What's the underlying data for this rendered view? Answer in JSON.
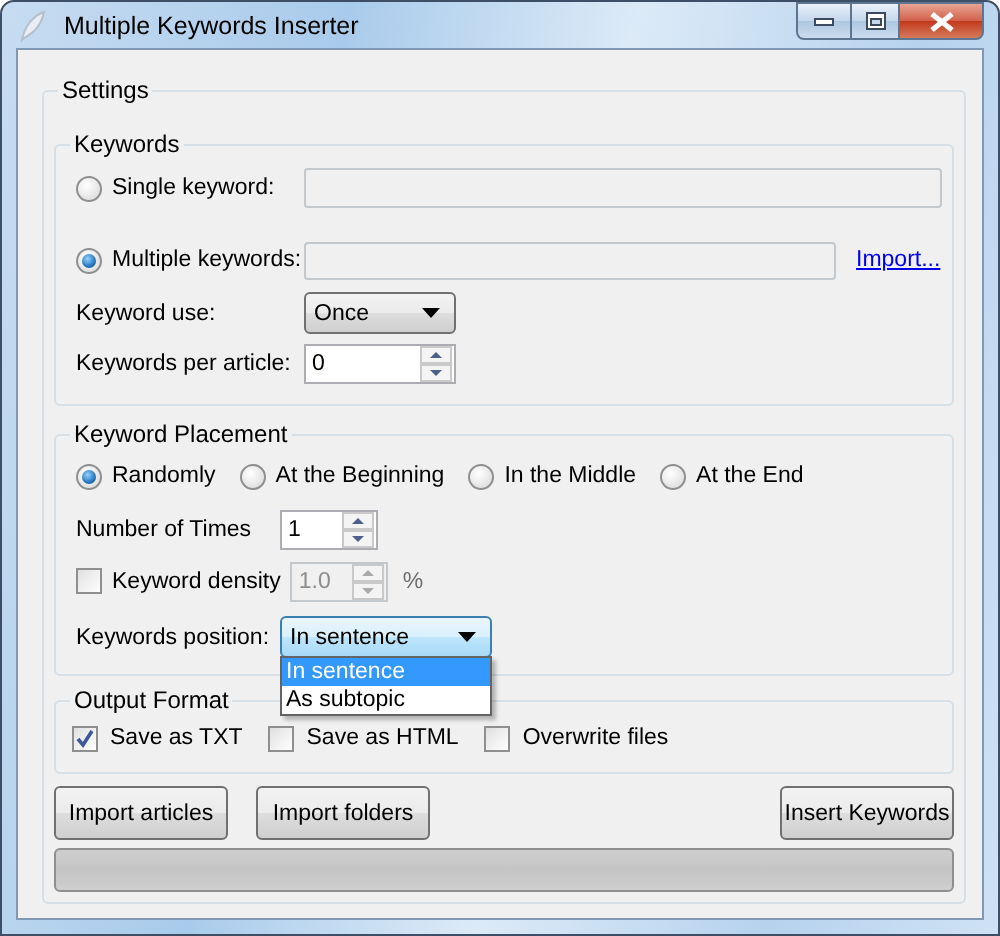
{
  "window": {
    "title": "Multiple Keywords Inserter"
  },
  "settings": {
    "title": "Settings",
    "keywords": {
      "title": "Keywords",
      "single": {
        "label": "Single keyword:",
        "selected": false
      },
      "multiple": {
        "label": "Multiple keywords:",
        "selected": true,
        "link": "Import..."
      },
      "keyword_use": {
        "label": "Keyword use:",
        "value": "Once"
      },
      "per_article": {
        "label": "Keywords per article:",
        "value": "0"
      }
    },
    "placement": {
      "title": "Keyword Placement",
      "options": [
        {
          "label": "Randomly",
          "selected": true
        },
        {
          "label": "At the Beginning",
          "selected": false
        },
        {
          "label": "In the Middle",
          "selected": false
        },
        {
          "label": "At the End",
          "selected": false
        }
      ],
      "times": {
        "label": "Number of Times",
        "value": "1"
      },
      "density": {
        "label": "Keyword density",
        "checked": false,
        "value": "1.0",
        "unit": "%"
      },
      "position": {
        "label": "Keywords position:",
        "value": "In sentence",
        "expanded": true,
        "options": [
          {
            "label": "In sentence",
            "selected": true
          },
          {
            "label": "As subtopic",
            "selected": false
          }
        ]
      }
    },
    "output": {
      "title": "Output Format",
      "options": [
        {
          "label": "Save as TXT",
          "checked": true
        },
        {
          "label": "Save as HTML",
          "checked": false
        },
        {
          "label": "Overwrite files",
          "checked": false
        }
      ]
    },
    "buttons": [
      "Import articles",
      "Import folders",
      "Insert Keywords"
    ],
    "progress": {
      "level": 0
    }
  }
}
